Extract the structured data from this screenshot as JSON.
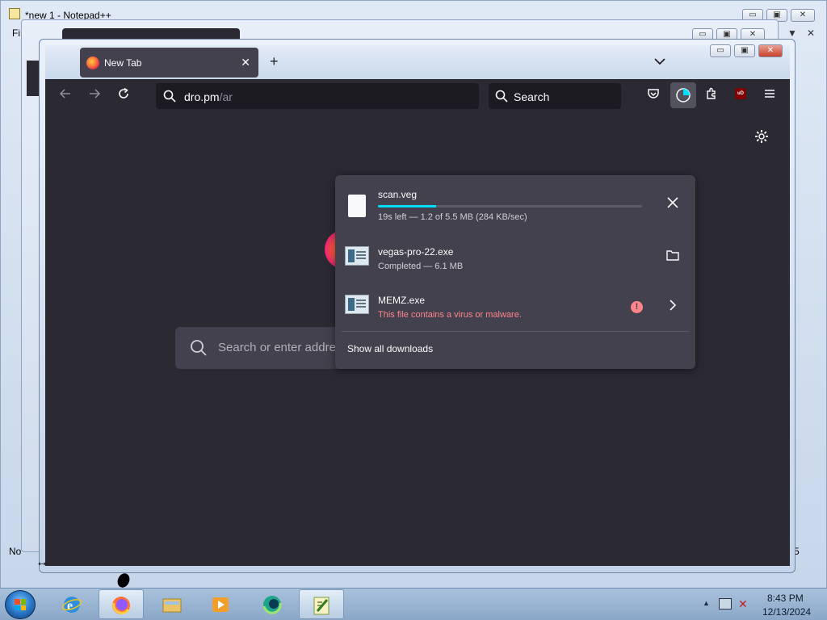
{
  "notepad": {
    "title": "*new 1 - Notepad++",
    "menu_peek": "Fi",
    "menu_arrow": "▼",
    "menu_close": "✕",
    "status_left": "No",
    "status_right": "5",
    "buttons": {
      "minimize": "▭",
      "maximize": "▣",
      "close": "✕"
    }
  },
  "firefox": {
    "tab": {
      "label": "New Tab",
      "close": "✕"
    },
    "new_tab_symbol": "+",
    "list_tabs_symbol": "⌄",
    "window_buttons": {
      "minimize": "▭",
      "maximize": "▣",
      "close": "✕"
    },
    "url": {
      "host": "dro.pm",
      "path": "/ar"
    },
    "search_placeholder": "Search",
    "ublock_label": "uD",
    "newtab_search_placeholder": "Search or enter address"
  },
  "downloads": {
    "items": [
      {
        "name": "scan.veg",
        "status": "19s left — 1.2 of 5.5 MB (284 KB/sec)",
        "progress": 0.22,
        "action": "cancel",
        "icon": "document-icon"
      },
      {
        "name": "vegas-pro-22.exe",
        "status": "Completed — 6.1 MB",
        "action": "open-folder",
        "icon": "exe-icon"
      },
      {
        "name": "MEMZ.exe",
        "status": "This file contains a virus or malware.",
        "action": "details",
        "icon": "exe-icon",
        "warning_symbol": "!"
      }
    ],
    "show_all": "Show all downloads"
  },
  "taskbar": {
    "time": "8:43 PM",
    "date": "12/13/2024",
    "apps": [
      "internet-explorer",
      "firefox",
      "file-explorer",
      "media-player",
      "browser-app",
      "notepad-plus-plus"
    ],
    "active_app": "notepad-plus-plus"
  },
  "colors": {
    "accent_progress": "#00ddff",
    "warning": "#ff848b",
    "panel_bg": "#42414d",
    "content_bg": "#2b2a33"
  }
}
